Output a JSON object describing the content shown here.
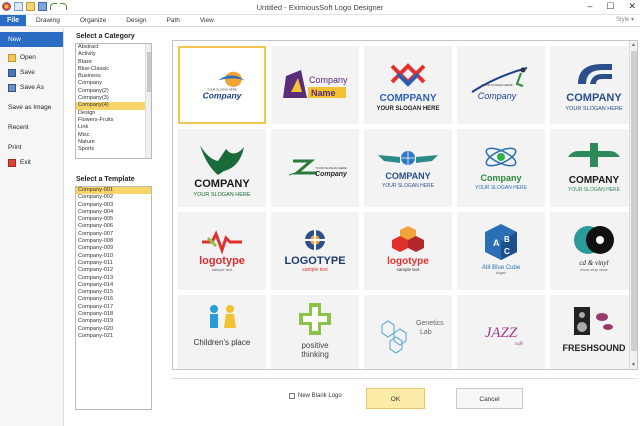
{
  "window": {
    "title": "Untitled - EximiousSoft Logo Designer",
    "controls": [
      "–",
      "☐",
      "✕"
    ]
  },
  "ribbon": {
    "file_tab": "File",
    "tabs": [
      "Drawing",
      "Organize",
      "Design",
      "Path",
      "View"
    ],
    "style_menu": "Style ▾"
  },
  "backstage": {
    "items": [
      {
        "label": "New",
        "icon": "new-doc-icon"
      },
      {
        "label": "Open",
        "icon": "folder-open-icon"
      },
      {
        "label": "Save",
        "icon": "floppy-icon"
      },
      {
        "label": "Save As",
        "icon": "floppy-as-icon"
      },
      {
        "label": "Save as Image",
        "icon": ""
      },
      {
        "label": "Recent",
        "icon": ""
      },
      {
        "label": "Print",
        "icon": ""
      },
      {
        "label": "Exit",
        "icon": "exit-icon"
      }
    ]
  },
  "categories": {
    "label": "Select a Category",
    "items": [
      "Abstract",
      "Activity",
      "Blaze",
      "Blue-Classic",
      "Business",
      "Company",
      "Company(2)",
      "Company(3)",
      "Company(4)",
      "Design",
      "Flowers-Fruits",
      "Link",
      "Misc",
      "Nature",
      "Sports"
    ],
    "selected": "Company(4)"
  },
  "templates": {
    "label": "Select a Template",
    "items": [
      "Company-001",
      "Company-002",
      "Company-003",
      "Company-004",
      "Company-005",
      "Company-006",
      "Company-007",
      "Company-008",
      "Company-009",
      "Company-010",
      "Company-011",
      "Company-012",
      "Company-013",
      "Company-014",
      "Company-015",
      "Company-016",
      "Company-017",
      "Company-018",
      "Company-019",
      "Company-020",
      "Company-021"
    ],
    "selected": "Company-001"
  },
  "gallery": {
    "tiles": [
      {
        "lines": [
          "YOUR SLOGAN HERE",
          "Company"
        ]
      },
      {
        "lines": [
          "Company",
          "Name"
        ]
      },
      {
        "lines": [
          "COMPPANY",
          "YOUR SLOGAN HERE"
        ]
      },
      {
        "lines": [
          "YOUR SLOGAN HERE",
          "Company"
        ]
      },
      {
        "lines": [
          "COMPANY",
          "YOUR SLOGAN HERE"
        ]
      },
      {
        "lines": [
          "COMPANY",
          "YOUR SLOGAN HERE"
        ]
      },
      {
        "lines": [
          "YOUR SLOGAN HERE",
          "Company"
        ]
      },
      {
        "lines": [
          "COMPANY",
          "YOUR SLOGAN HERE"
        ]
      },
      {
        "lines": [
          "Company",
          "YOUR SLOGAN HERE"
        ]
      },
      {
        "lines": [
          "COMPANY",
          "YOUR SLOGAN HERE"
        ]
      },
      {
        "lines": [
          "logotype",
          "sample text"
        ]
      },
      {
        "lines": [
          "LOGOTYPE",
          "sample text"
        ]
      },
      {
        "lines": [
          "logotype",
          "sample text"
        ]
      },
      {
        "lines": [
          "Atit Blue Cube",
          "slogan"
        ]
      },
      {
        "lines": [
          "cd & vinyl",
          "music shop name"
        ]
      },
      {
        "lines": [
          "Children's place",
          ""
        ]
      },
      {
        "lines": [
          "positive",
          "thinking"
        ]
      },
      {
        "lines": [
          "Genetics",
          "Lab"
        ]
      },
      {
        "lines": [
          "JAZZ",
          "café"
        ]
      },
      {
        "lines": [
          "FRESHSOUND",
          ""
        ]
      }
    ]
  },
  "footer": {
    "checkbox_label": "New Blank Logo",
    "ok_label": "OK",
    "cancel_label": "Cancel"
  }
}
